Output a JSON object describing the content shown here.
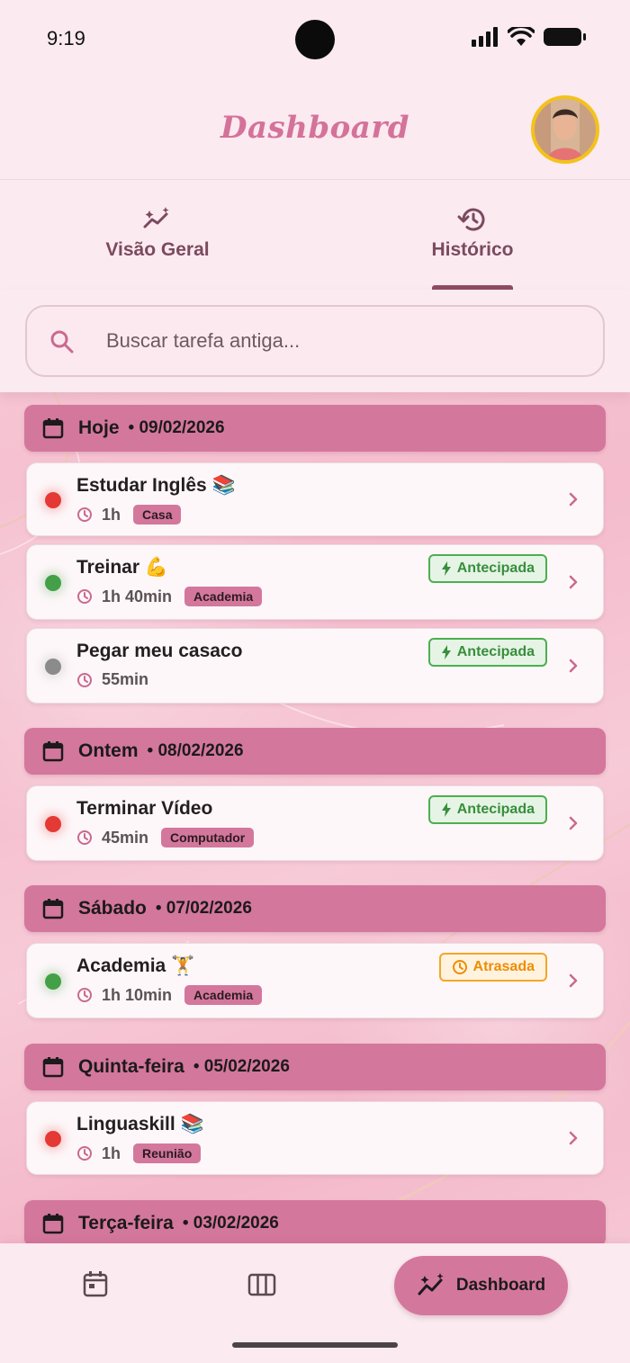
{
  "status_bar": {
    "time": "9:19"
  },
  "header": {
    "title": "Dashboard",
    "avatar_icon": "user-avatar"
  },
  "tabs": [
    {
      "label": "Visão Geral",
      "icon": "trend-sparkle-icon",
      "active": false
    },
    {
      "label": "Histórico",
      "icon": "history-icon",
      "active": true
    }
  ],
  "search": {
    "placeholder": "Buscar tarefa antiga...",
    "value": ""
  },
  "groups": [
    {
      "day": "Hoje",
      "date": "• 09/02/2026",
      "tasks": [
        {
          "title": "Estudar Inglês 📚",
          "duration": "1h",
          "tag": "Casa",
          "status": "red",
          "badge": ""
        },
        {
          "title": "Treinar 💪",
          "duration": "1h 40min",
          "tag": "Academia",
          "status": "green",
          "badge": "Antecipada"
        },
        {
          "title": "Pegar meu casaco",
          "duration": "55min",
          "tag": "",
          "status": "gray",
          "badge": "Antecipada"
        }
      ]
    },
    {
      "day": "Ontem",
      "date": "• 08/02/2026",
      "tasks": [
        {
          "title": "Terminar Vídeo",
          "duration": "45min",
          "tag": "Computador",
          "status": "red",
          "badge": "Antecipada"
        }
      ]
    },
    {
      "day": "Sábado",
      "date": "• 07/02/2026",
      "tasks": [
        {
          "title": "Academia 🏋️",
          "duration": "1h 10min",
          "tag": "Academia",
          "status": "green",
          "badge": "Atrasada"
        }
      ]
    },
    {
      "day": "Quinta-feira",
      "date": "• 05/02/2026",
      "tasks": [
        {
          "title": "Linguaskill 📚",
          "duration": "1h",
          "tag": "Reunião",
          "status": "red",
          "badge": ""
        }
      ]
    },
    {
      "day": "Terça-feira",
      "date": "• 03/02/2026",
      "tasks": []
    }
  ],
  "bottom_nav": {
    "items": [
      {
        "icon": "calendar-icon",
        "label": ""
      },
      {
        "icon": "columns-icon",
        "label": ""
      },
      {
        "icon": "dashboard-sparkle-icon",
        "label": "Dashboard",
        "active": true
      }
    ]
  },
  "colors": {
    "accent": "#d4779c",
    "title": "#d4729a",
    "tab_text": "#7b4a5e",
    "early_badge": "#388e3c",
    "late_badge": "#ef8c00"
  }
}
